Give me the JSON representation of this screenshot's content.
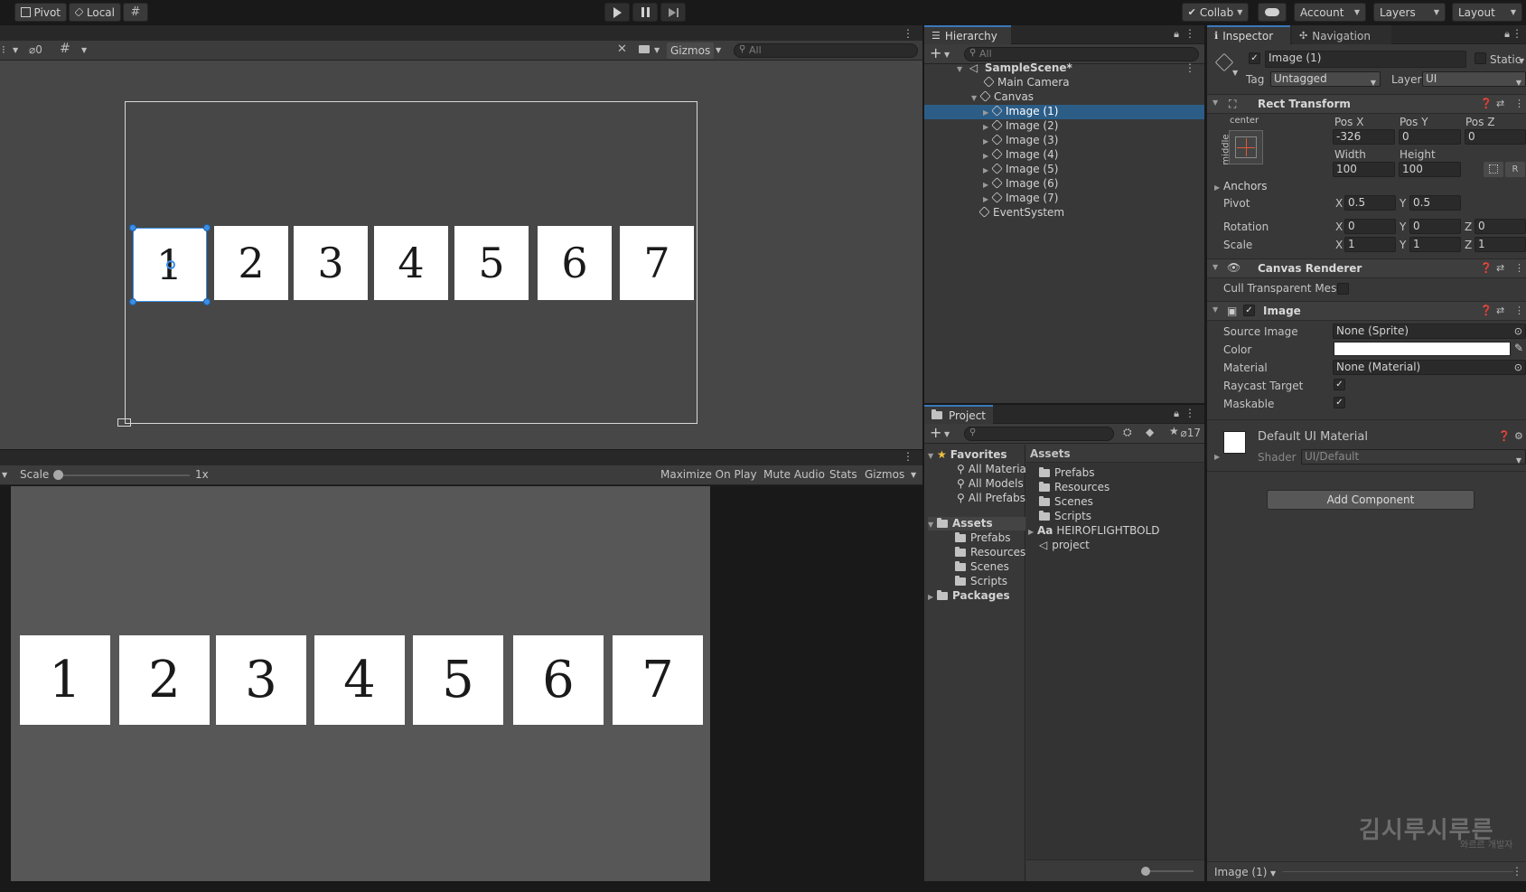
{
  "toolbar": {
    "pivot": "Pivot",
    "local": "Local",
    "collab": "Collab",
    "account": "Account",
    "layers": "Layers",
    "layout": "Layout"
  },
  "scene": {
    "hidden_count": "0",
    "gizmos": "Gizmos",
    "search_placeholder": "All",
    "tiles": [
      "1",
      "2",
      "3",
      "4",
      "5",
      "6",
      "7"
    ]
  },
  "game": {
    "scale_label": "Scale",
    "scale_value": "1x",
    "maximize": "Maximize On Play",
    "mute": "Mute Audio",
    "stats": "Stats",
    "gizmos": "Gizmos",
    "tiles": [
      "1",
      "2",
      "3",
      "4",
      "5",
      "6",
      "7"
    ]
  },
  "hierarchy": {
    "tab": "Hierarchy",
    "search_placeholder": "All",
    "scene": "SampleScene*",
    "items": [
      "Main Camera",
      "Canvas",
      "Image (1)",
      "Image (2)",
      "Image (3)",
      "Image (4)",
      "Image (5)",
      "Image (6)",
      "Image (7)",
      "EventSystem"
    ]
  },
  "project": {
    "tab": "Project",
    "hidden_count": "17",
    "favorites": "Favorites",
    "fav_items": [
      "All Materia",
      "All Models",
      "All Prefabs"
    ],
    "assets": "Assets",
    "asset_folders": [
      "Prefabs",
      "Resources",
      "Scenes",
      "Scripts"
    ],
    "packages": "Packages",
    "list_header": "Assets",
    "list_items": [
      "Prefabs",
      "Resources",
      "Scenes",
      "Scripts"
    ],
    "font_asset": "HEIROFLIGHTBOLD",
    "font_prefix": "Aa",
    "scene_asset": "project"
  },
  "inspector": {
    "tab": "Inspector",
    "nav_tab": "Navigation",
    "name": "Image (1)",
    "static": "Static",
    "tag_label": "Tag",
    "tag_value": "Untagged",
    "layer_label": "Layer",
    "layer_value": "UI",
    "rect": {
      "title": "Rect Transform",
      "anchor_h": "center",
      "anchor_v": "middle",
      "posx_label": "Pos X",
      "posx": "-326",
      "posy_label": "Pos Y",
      "posy": "0",
      "posz_label": "Pos Z",
      "posz": "0",
      "width_label": "Width",
      "width": "100",
      "height_label": "Height",
      "height": "100",
      "r_button": "R",
      "anchors": "Anchors",
      "pivot": "Pivot",
      "pivot_x": "0.5",
      "pivot_y": "0.5",
      "rotation": "Rotation",
      "rot_x": "0",
      "rot_y": "0",
      "rot_z": "0",
      "scale": "Scale",
      "scale_x": "1",
      "scale_y": "1",
      "scale_z": "1",
      "x": "X",
      "y": "Y",
      "z": "Z"
    },
    "canvas_renderer": {
      "title": "Canvas Renderer",
      "cull": "Cull Transparent Mes"
    },
    "image": {
      "title": "Image",
      "source_label": "Source Image",
      "source": "None (Sprite)",
      "color_label": "Color",
      "material_label": "Material",
      "material": "None (Material)",
      "raycast": "Raycast Target",
      "maskable": "Maskable"
    },
    "material": {
      "name": "Default UI Material",
      "shader_label": "Shader",
      "shader": "UI/Default"
    },
    "add_component": "Add Component",
    "footer": "Image (1)"
  },
  "watermark": {
    "main": "김시루시루른",
    "sub": "와르르 개발자"
  }
}
